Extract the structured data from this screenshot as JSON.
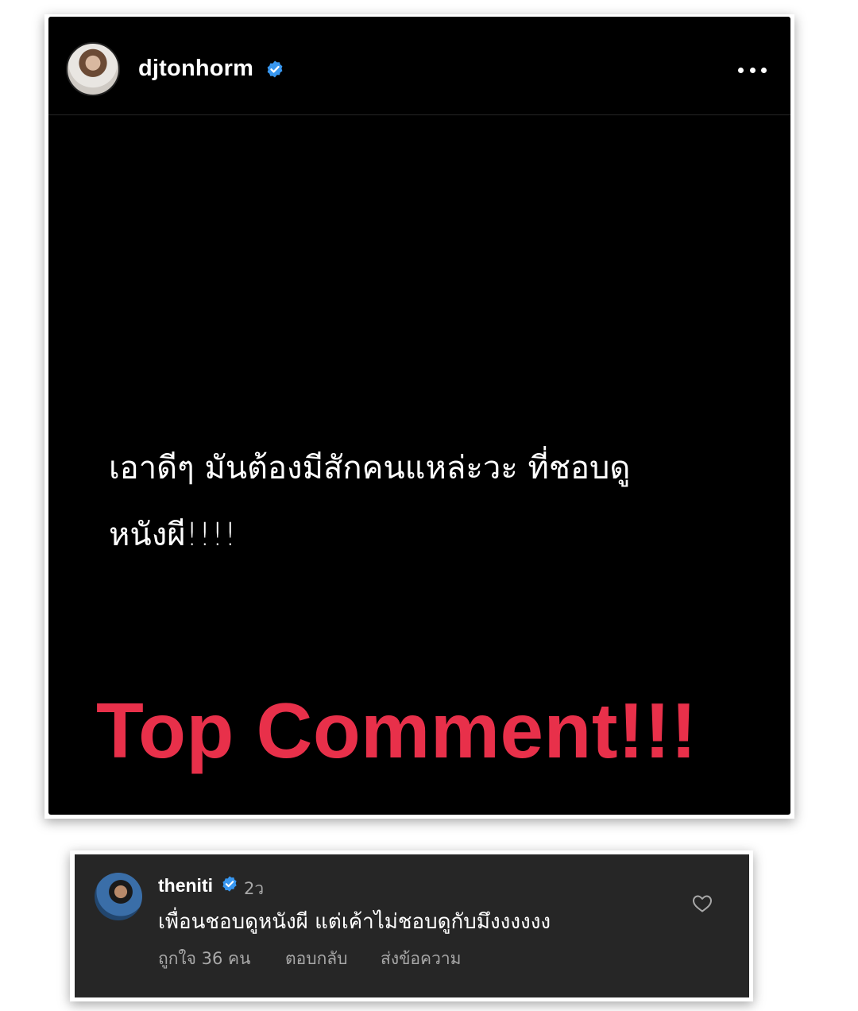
{
  "post": {
    "username": "djtonhorm",
    "verified": true,
    "text_line1": "เอาดีๆ มันต้องมีสักคนแหล่ะวะ ที่ชอบดู",
    "text_line2": "หนังผี!!!!",
    "overlay_text": "Top Comment!!!",
    "icons": {
      "avatar": "avatar-photo",
      "verified": "verified-badge-icon",
      "more": "more-options-icon"
    },
    "colors": {
      "background": "#000000",
      "overlay_text": "#e8304a",
      "verified": "#3897f0"
    }
  },
  "comment": {
    "username": "theniti",
    "verified": true,
    "time": "2ว",
    "text": "เพื่อนชอบดูหนังผี แต่เค้าไม่ชอบดูกับมึงงงงงง",
    "likes_label": "ถูกใจ 36 คน",
    "reply_label": "ตอบกลับ",
    "send_label": "ส่งข้อความ",
    "icons": {
      "like": "heart-outline-icon"
    },
    "colors": {
      "background": "#262626",
      "secondary_text": "#a8a8a8"
    }
  }
}
